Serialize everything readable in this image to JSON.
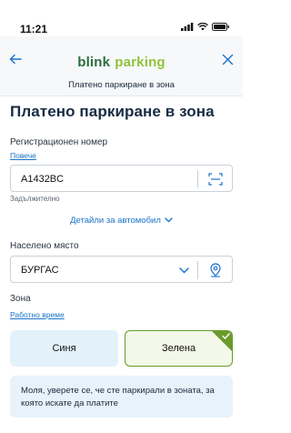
{
  "status_bar": {
    "time": "11:21"
  },
  "header": {
    "brand_part1": "blink",
    "brand_part2": "parking",
    "subtitle": "Платено паркиране в зона"
  },
  "page": {
    "title": "Платено паркиране в зона"
  },
  "registration": {
    "label": "Регистрационен номер",
    "more_link": "Повече",
    "value": "A1432BC",
    "required_hint": "Задължително",
    "details_link": "Детайли за автомобил"
  },
  "settlement": {
    "label": "Населено място",
    "value": "БУРГАС"
  },
  "zone": {
    "label": "Зона",
    "work_time_link": "Работно време",
    "options": [
      "Синя",
      "Зелена"
    ],
    "selected": "Зелена"
  },
  "info": {
    "message": "Моля, уверете се, че сте паркирали в зоната, за която искате да  платите"
  },
  "colors": {
    "brand_green": "#2b6e3d",
    "brand_lime": "#8fc33b",
    "link_blue": "#1a73c9",
    "selected_green": "#6a9a2b"
  }
}
